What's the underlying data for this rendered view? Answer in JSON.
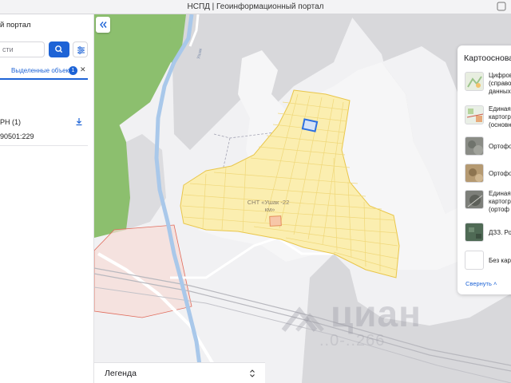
{
  "window": {
    "title": "НСПД | Геоинформационный портал"
  },
  "sidebar": {
    "title": "й портал",
    "search_placeholder": "сти",
    "selected_tab_label": "Выделенные объекты",
    "selected_count": "1",
    "egrn_label": "РН (1)",
    "cadastral_number": "90501:229"
  },
  "map": {
    "snt_label_line1": "СНТ «Ушак -22",
    "snt_label_line2": "км»",
    "river_label": "Ушак",
    "colors": {
      "allotment_fill": "#fbeeb0",
      "allotment_stroke": "#e9c64a",
      "selected_parcel": "#2d6fe0",
      "forest": "#8cbf6e",
      "water": "#a9c8ea",
      "zone_stroke": "#e06a5a"
    }
  },
  "basemap_panel": {
    "title": "Картооснова",
    "items": [
      {
        "label": "Цифров\n(справо\nданных",
        "icon": "digital-map-icon"
      },
      {
        "label": "Единая\nкартогр\n(основн",
        "icon": "unified-map-icon"
      },
      {
        "label": "Ортофо",
        "icon": "orthophoto-icon"
      },
      {
        "label": "Ортофо",
        "icon": "orthophoto-icon"
      },
      {
        "label": "Единая\nкартогр\n(ортоф",
        "icon": "unified-ortho-icon"
      },
      {
        "label": "ДЗЗ. Ро",
        "icon": "satellite-icon"
      },
      {
        "label": "Без карт",
        "icon": "blank-map-icon"
      }
    ],
    "collapse_label": "Свернуть"
  },
  "legend": {
    "label": "Легенда"
  },
  "watermark": {
    "brand": "циан",
    "code": "..0-..266"
  }
}
